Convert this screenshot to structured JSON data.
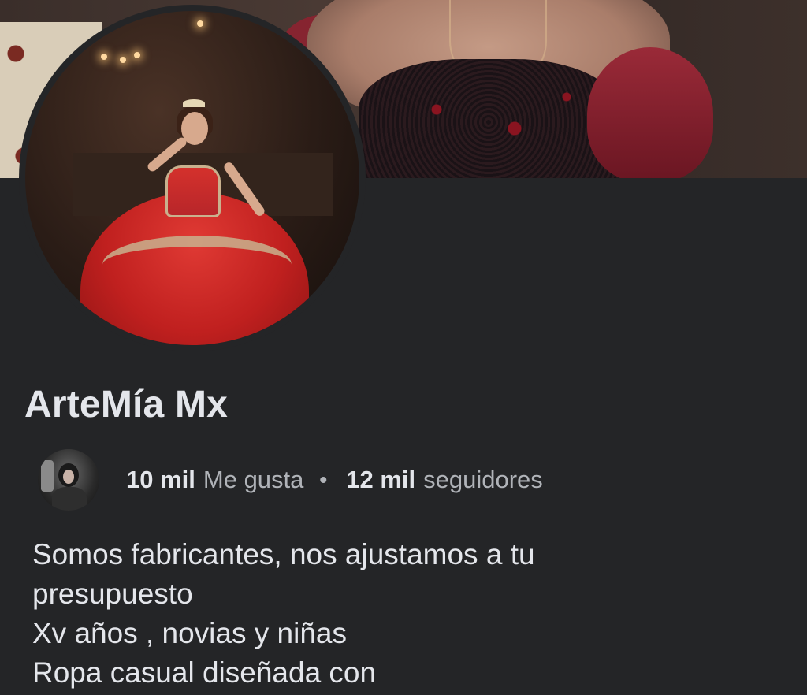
{
  "profile": {
    "name": "ArteMía Mx",
    "likes_count": "10 mil",
    "likes_label": "Me gusta",
    "separator": "•",
    "followers_count": "12 mil",
    "followers_label": "seguidores"
  },
  "bio": {
    "lines": [
      "Somos fabricantes, nos ajustamos a tu",
      "presupuesto",
      "Xv años , novias y niñas",
      "Ropa casual diseñada con"
    ]
  },
  "colors": {
    "background": "#242527",
    "primary_text": "#e4e6eb",
    "secondary_text": "#b0b3b8"
  }
}
